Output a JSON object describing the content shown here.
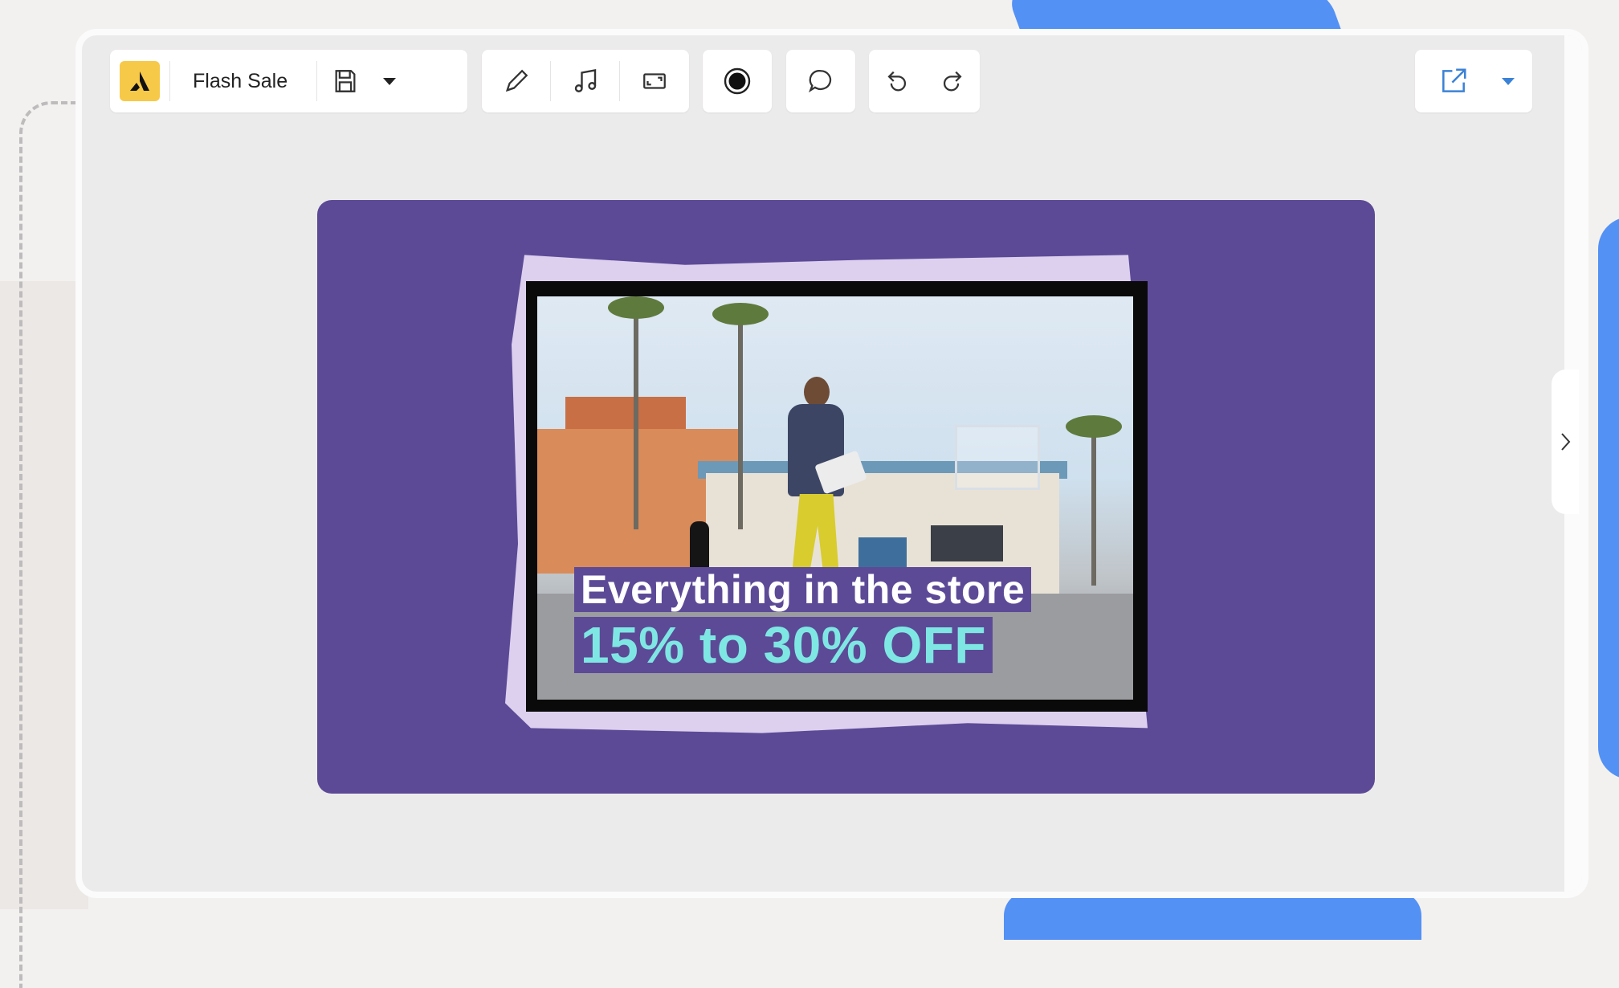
{
  "toolbar": {
    "project_title": "Flash Sale",
    "logo_icon": "brand-logo-icon",
    "icons": {
      "save": "save-icon",
      "save_menu": "chevron-down-icon",
      "draw": "pencil-icon",
      "audio": "music-note-icon",
      "resize": "aspect-ratio-icon",
      "record": "record-icon",
      "comment": "speech-bubble-icon",
      "undo": "undo-icon",
      "redo": "redo-icon",
      "share": "share-external-icon",
      "share_menu": "chevron-down-icon"
    }
  },
  "canvas": {
    "caption_line_1": "Everything in the store",
    "caption_line_2": "15% to 30% OFF"
  },
  "panel": {
    "toggle_icon": "chevron-right-icon"
  },
  "colors": {
    "canvas_bg": "#5c4a97",
    "logo_bg": "#f7c948",
    "caption_accent": "#7fe7e3",
    "share_accent": "#3b82d6",
    "decor_blue": "#5391f5"
  }
}
